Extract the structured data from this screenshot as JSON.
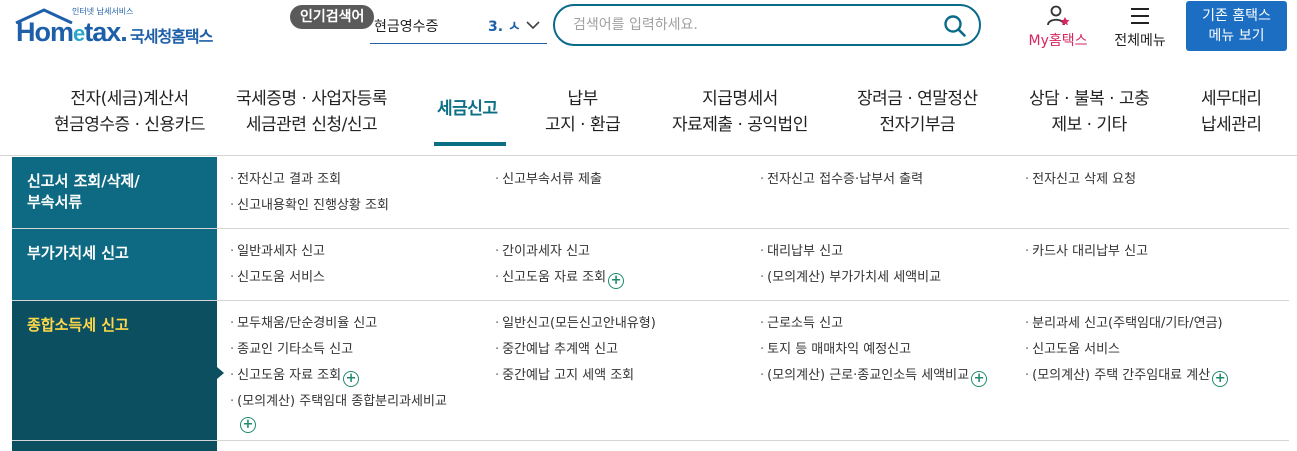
{
  "header": {
    "logo_tagline": "인터넷 납세서비스",
    "logo_brand_a": "Hom",
    "logo_brand_e": "e",
    "logo_brand_b": "tax.",
    "logo_korean": "국세청홈택스",
    "popular_label": "인기검색어",
    "popular_rank_text": "현금영수증",
    "popular_rank_num": "3. ㅅ",
    "search_placeholder": "검색어를 입력하세요.",
    "my_hometax": "My홈택스",
    "all_menu": "전체메뉴",
    "legacy_line1": "기존 홈택스",
    "legacy_line2": "메뉴 보기",
    "colors": {
      "brand": "#1d5fa8",
      "accent": "#0b6f86",
      "my": "#d6275e",
      "legacy_btn": "#1b6ec2"
    }
  },
  "gnb": [
    {
      "line1": "전자(세금)계산서",
      "line2": "현금영수증 · 신용카드"
    },
    {
      "line1": "국세증명 · 사업자등록",
      "line2": "세금관련 신청/신고"
    },
    {
      "line1": "세금신고",
      "line2": "",
      "active": true
    },
    {
      "line1": "납부",
      "line2": "고지 · 환급"
    },
    {
      "line1": "지급명세서",
      "line2": "자료제출 · 공익법인"
    },
    {
      "line1": "장려금 · 연말정산",
      "line2": "전자기부금"
    },
    {
      "line1": "상담 · 불복 · 고충",
      "line2": "제보 · 기타"
    },
    {
      "line1": "세무대리",
      "line2": "납세관리"
    }
  ],
  "sections": [
    {
      "title_line1": "신고서 조회/삭제/",
      "title_line2": "부속서류",
      "links": [
        "전자신고 결과 조회",
        "신고부속서류 제출",
        "전자신고 접수증·납부서 출력",
        "전자신고 삭제 요청",
        "신고내용확인 진행상황 조회"
      ]
    },
    {
      "title_line1": "부가가치세 신고",
      "links": [
        "일반과세자 신고",
        "간이과세자 신고",
        "대리납부 신고",
        "카드사 대리납부 신고",
        "신고도움 서비스",
        "신고도움 자료 조회",
        "(모의계산) 부가가치세 세액비교"
      ]
    },
    {
      "title_line1": "종합소득세 신고",
      "active": true,
      "links": [
        "모두채움/단순경비율 신고",
        "일반신고(모든신고안내유형)",
        "근로소득 신고",
        "분리과세 신고(주택임대/기타/연금)",
        "종교인 기타소득 신고",
        "중간예납 추계액 신고",
        "토지 등 매매차익 예정신고",
        "신고도움 서비스",
        "신고도움 자료 조회",
        "중간예납 고지 세액 조회",
        "(모의계산) 근로·종교인소득 세액비교",
        "(모의계산) 주택 간주임대료 계산",
        "(모의계산) 주택임대 종합분리과세비교"
      ]
    }
  ]
}
